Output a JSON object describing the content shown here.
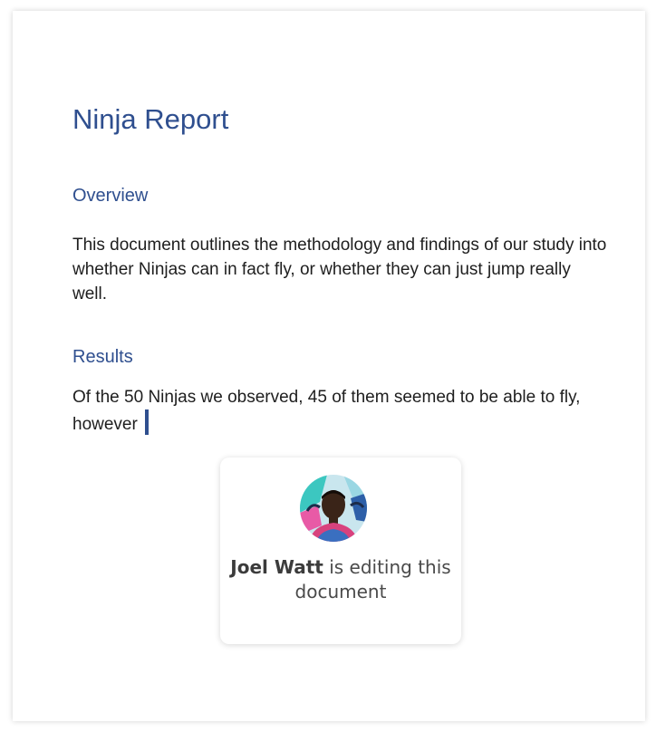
{
  "document": {
    "title": "Ninja Report",
    "sections": [
      {
        "heading": "Overview",
        "body": "This document outlines the methodology and findings of our study into whether Ninjas can in fact fly, or whether they can just jump really well."
      },
      {
        "heading": "Results",
        "body": "Of the 50 Ninjas we observed, 45 of them seemed to be able to fly, however"
      }
    ]
  },
  "presence": {
    "user_name": "Joel Watt",
    "status_text": "is editing this document",
    "avatar_icon": "user-avatar",
    "accent_color": "#2f4f8f"
  }
}
